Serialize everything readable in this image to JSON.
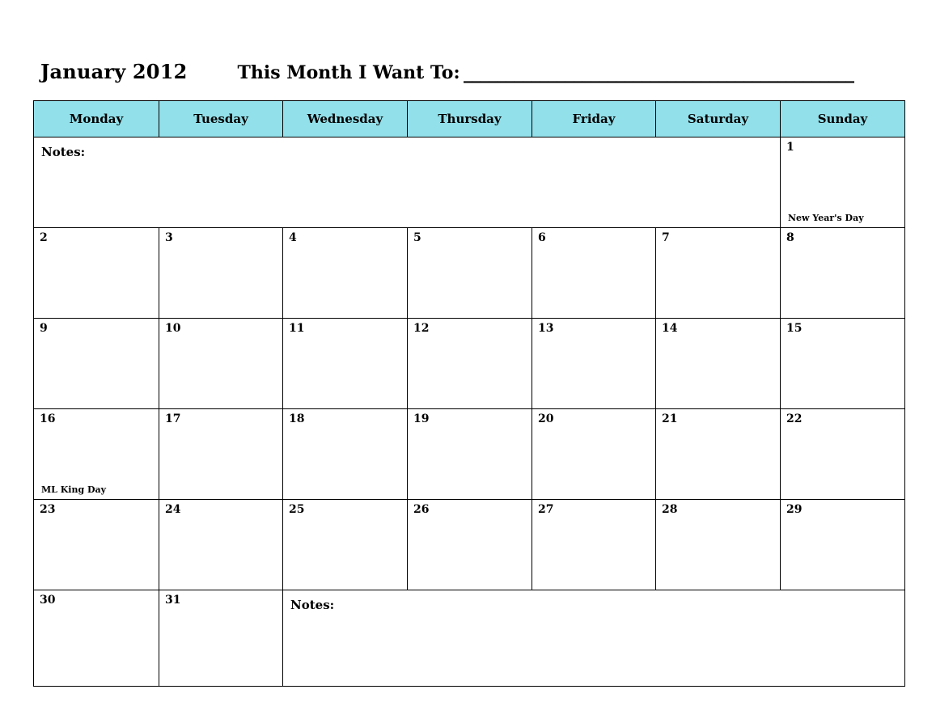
{
  "header": {
    "month_title": "January 2012",
    "want_to_label": "This Month I Want To:",
    "want_to_blank": "______________________________________________"
  },
  "calendar": {
    "weekday_headers": [
      "Monday",
      "Tuesday",
      "Wednesday",
      "Thursday",
      "Friday",
      "Saturday",
      "Sunday"
    ],
    "notes_label_top": "Notes:",
    "notes_label_bottom": "Notes:",
    "accent_color": "#92E0EA",
    "border_color": "#000000",
    "weeks": [
      {
        "cells": [
          {
            "type": "notes",
            "label": "Notes:",
            "span": 6
          },
          {
            "type": "day",
            "num": "1",
            "holiday": "New Year's Day"
          }
        ]
      },
      {
        "cells": [
          {
            "type": "day",
            "num": "2",
            "holiday": ""
          },
          {
            "type": "day",
            "num": "3",
            "holiday": ""
          },
          {
            "type": "day",
            "num": "4",
            "holiday": ""
          },
          {
            "type": "day",
            "num": "5",
            "holiday": ""
          },
          {
            "type": "day",
            "num": "6",
            "holiday": ""
          },
          {
            "type": "day",
            "num": "7",
            "holiday": ""
          },
          {
            "type": "day",
            "num": "8",
            "holiday": ""
          }
        ]
      },
      {
        "cells": [
          {
            "type": "day",
            "num": "9",
            "holiday": ""
          },
          {
            "type": "day",
            "num": "10",
            "holiday": ""
          },
          {
            "type": "day",
            "num": "11",
            "holiday": ""
          },
          {
            "type": "day",
            "num": "12",
            "holiday": ""
          },
          {
            "type": "day",
            "num": "13",
            "holiday": ""
          },
          {
            "type": "day",
            "num": "14",
            "holiday": ""
          },
          {
            "type": "day",
            "num": "15",
            "holiday": ""
          }
        ]
      },
      {
        "cells": [
          {
            "type": "day",
            "num": "16",
            "holiday": "ML King Day"
          },
          {
            "type": "day",
            "num": "17",
            "holiday": ""
          },
          {
            "type": "day",
            "num": "18",
            "holiday": ""
          },
          {
            "type": "day",
            "num": "19",
            "holiday": ""
          },
          {
            "type": "day",
            "num": "20",
            "holiday": ""
          },
          {
            "type": "day",
            "num": "21",
            "holiday": ""
          },
          {
            "type": "day",
            "num": "22",
            "holiday": ""
          }
        ]
      },
      {
        "cells": [
          {
            "type": "day",
            "num": "23",
            "holiday": ""
          },
          {
            "type": "day",
            "num": "24",
            "holiday": ""
          },
          {
            "type": "day",
            "num": "25",
            "holiday": ""
          },
          {
            "type": "day",
            "num": "26",
            "holiday": ""
          },
          {
            "type": "day",
            "num": "27",
            "holiday": ""
          },
          {
            "type": "day",
            "num": "28",
            "holiday": ""
          },
          {
            "type": "day",
            "num": "29",
            "holiday": ""
          }
        ]
      },
      {
        "cells": [
          {
            "type": "day",
            "num": "30",
            "holiday": ""
          },
          {
            "type": "day",
            "num": "31",
            "holiday": ""
          },
          {
            "type": "notes",
            "label": "Notes:",
            "span": 5
          }
        ]
      }
    ]
  }
}
